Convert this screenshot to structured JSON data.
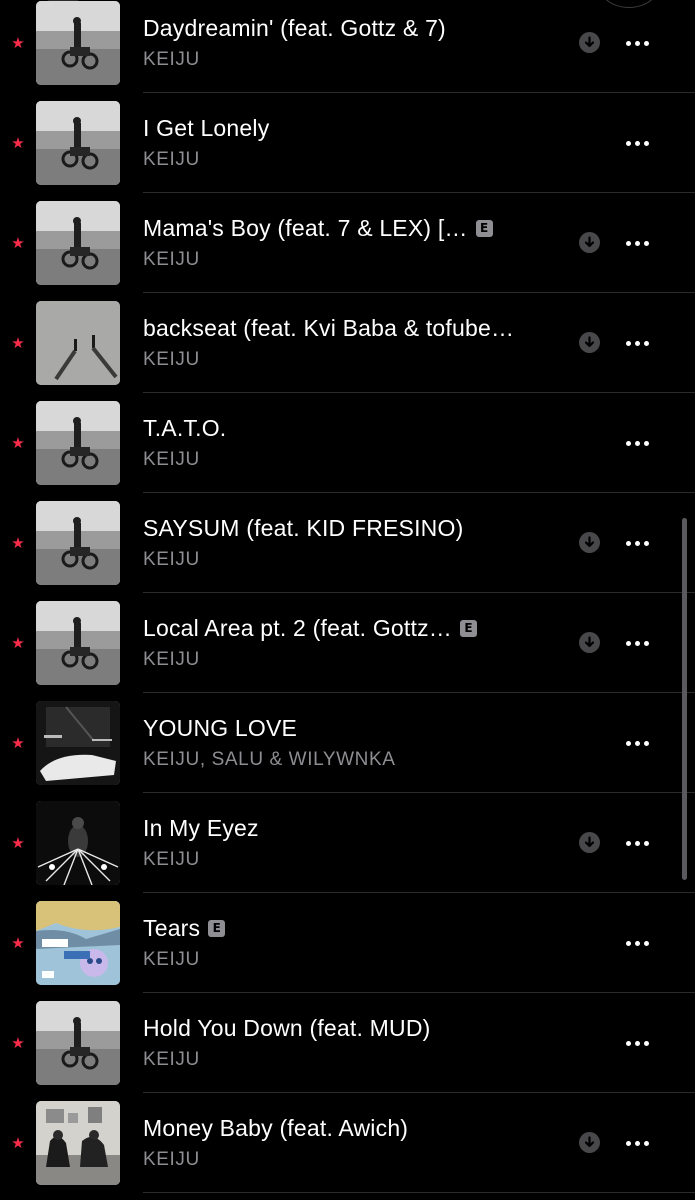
{
  "tracks": [
    {
      "title": "Daydreamin' (feat. Gottz & 7)",
      "artist": "KEIJU",
      "explicit": false,
      "downloaded": true,
      "art": "bike"
    },
    {
      "title": "I Get Lonely",
      "artist": "KEIJU",
      "explicit": false,
      "downloaded": false,
      "art": "bike"
    },
    {
      "title": "Mama's Boy (feat. 7 & LEX) […",
      "artist": "KEIJU",
      "explicit": true,
      "downloaded": true,
      "art": "bike"
    },
    {
      "title": "backseat (feat. Kvi Baba & tofube…",
      "artist": "KEIJU",
      "explicit": false,
      "downloaded": true,
      "art": "shadows"
    },
    {
      "title": "T.A.T.O.",
      "artist": "KEIJU",
      "explicit": false,
      "downloaded": false,
      "art": "bike"
    },
    {
      "title": "SAYSUM (feat. KID FRESINO)",
      "artist": "KEIJU",
      "explicit": false,
      "downloaded": true,
      "art": "bike"
    },
    {
      "title": "Local Area pt. 2 (feat. Gottz…",
      "artist": "KEIJU",
      "explicit": true,
      "downloaded": true,
      "art": "bike"
    },
    {
      "title": "YOUNG LOVE",
      "artist": "KEIJU, SALU & WILYWNKA",
      "explicit": false,
      "downloaded": false,
      "art": "car"
    },
    {
      "title": "In My Eyez",
      "artist": "KEIJU",
      "explicit": false,
      "downloaded": true,
      "art": "eyez"
    },
    {
      "title": "Tears",
      "artist": "KEIJU",
      "explicit": true,
      "downloaded": false,
      "art": "tears"
    },
    {
      "title": "Hold You Down (feat. MUD)",
      "artist": "KEIJU",
      "explicit": false,
      "downloaded": false,
      "art": "bike"
    },
    {
      "title": "Money Baby (feat. Awich)",
      "artist": "KEIJU",
      "explicit": false,
      "downloaded": true,
      "art": "room"
    }
  ],
  "icons": {
    "favorite": "star-icon",
    "explicit": "E",
    "download": "download-icon",
    "more": "more-icon"
  },
  "colors": {
    "accent": "#fa2d48",
    "background": "#000000",
    "secondary_text": "#8d8d92"
  }
}
